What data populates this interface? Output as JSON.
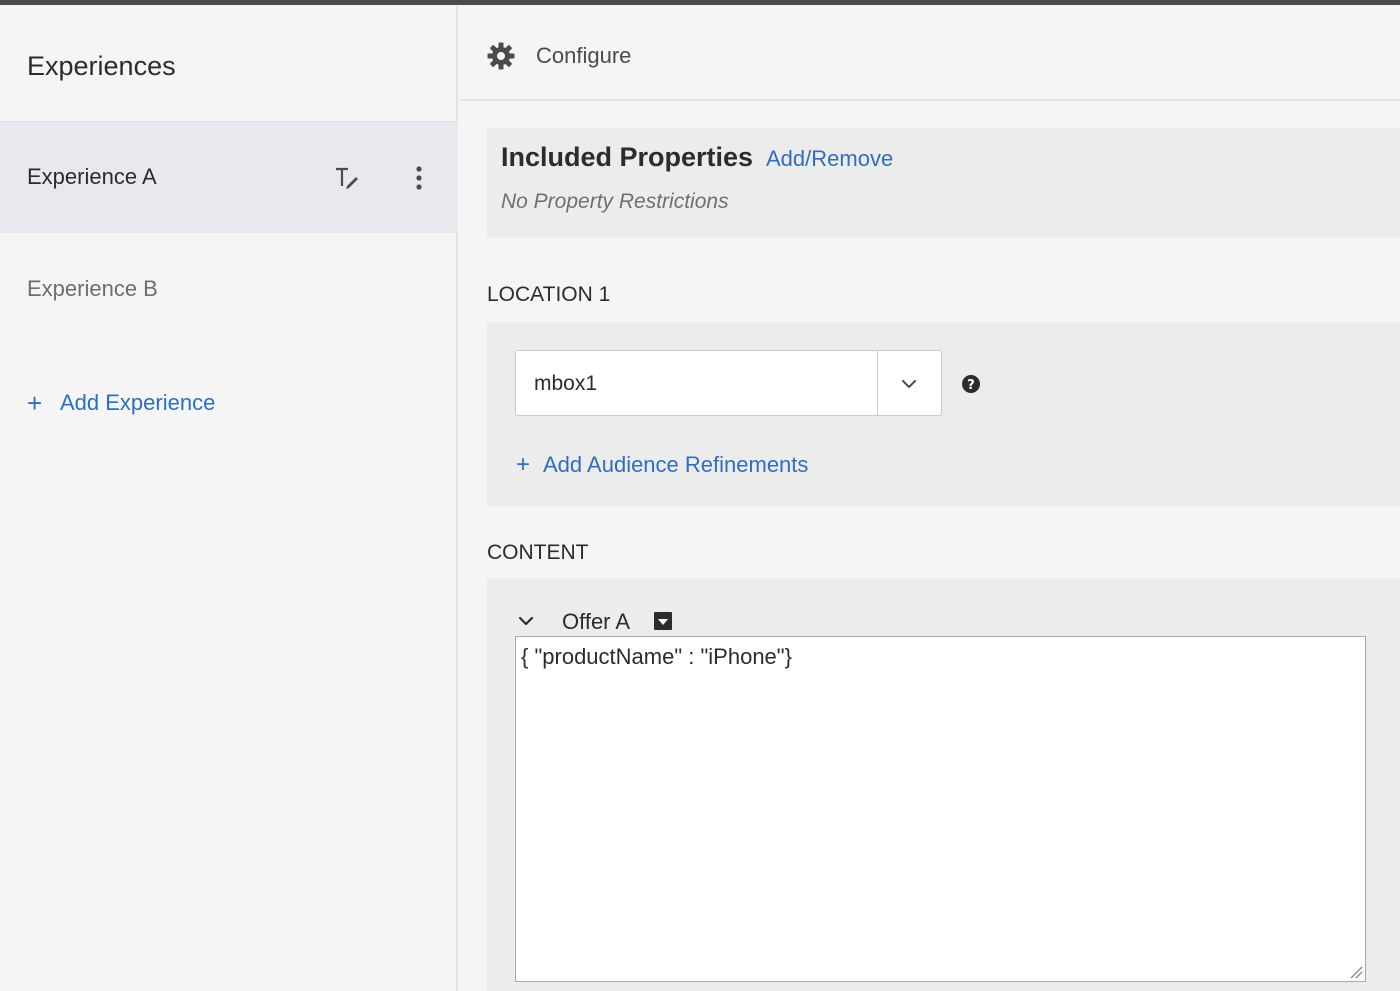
{
  "sidebar": {
    "title": "Experiences",
    "items": [
      {
        "label": "Experience A",
        "selected": true,
        "icons": [
          "rename-text-icon",
          "more-vertical-icon"
        ]
      },
      {
        "label": "Experience B",
        "selected": false
      }
    ],
    "add_label": "Add Experience",
    "add_icon": "plus-icon"
  },
  "header": {
    "icon": "gear-icon",
    "label": "Configure"
  },
  "included_properties": {
    "title": "Included Properties",
    "link": "Add/Remove",
    "status": "No Property Restrictions"
  },
  "location": {
    "section_label": "LOCATION 1",
    "mbox_value": "mbox1",
    "dropdown_icon": "chevron-down-icon",
    "help_icon": "help-icon",
    "add_refinements_label": "Add Audience Refinements"
  },
  "content": {
    "section_label": "CONTENT",
    "offer_label": "Offer A",
    "offer_code": "{ \"productName\" : \"iPhone\"}"
  },
  "colors": {
    "accent": "#2f6ec0",
    "selected_bg": "#e7e9ef",
    "panel_bg": "#ececec",
    "page_bg": "#f5f5f5"
  }
}
